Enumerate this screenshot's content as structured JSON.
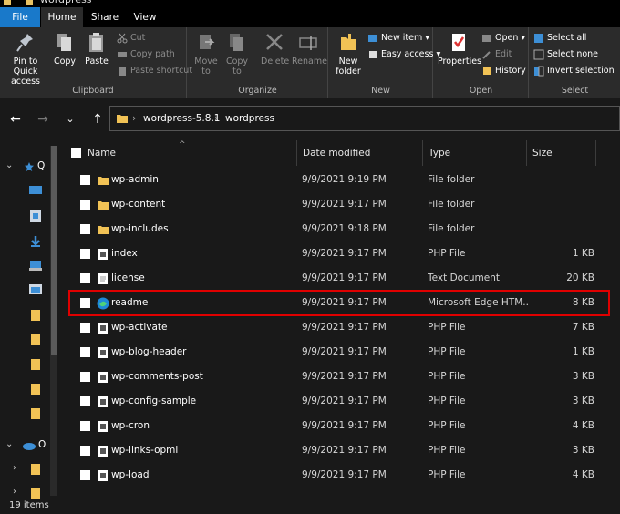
{
  "window": {
    "title": "wordpress"
  },
  "tabs": [
    {
      "label": "File",
      "active": false,
      "color": "#1979ca"
    },
    {
      "label": "Home",
      "active": true
    },
    {
      "label": "Share",
      "active": false
    },
    {
      "label": "View",
      "active": false
    }
  ],
  "ribbon": {
    "clipboard": {
      "label": "Clipboard",
      "pin": "Pin to Quick access",
      "copy": "Copy",
      "paste": "Paste",
      "cut": "Cut",
      "copy_path": "Copy path",
      "paste_shortcut": "Paste shortcut"
    },
    "organize": {
      "label": "Organize",
      "move_to": "Move to",
      "copy_to": "Copy to",
      "delete": "Delete",
      "rename": "Rename"
    },
    "new": {
      "label": "New",
      "new_folder": "New folder",
      "new_item": "New item",
      "easy_access": "Easy access"
    },
    "open": {
      "label": "Open",
      "properties": "Properties",
      "open": "Open",
      "edit": "Edit",
      "history": "History"
    },
    "select": {
      "label": "Select",
      "select_all": "Select all",
      "select_none": "Select none",
      "invert_selection": "Invert selection"
    }
  },
  "address": {
    "segments": [
      "wordpress-5.8.1",
      "wordpress"
    ]
  },
  "nav_pane": {
    "quick_access_initial": "Q",
    "onedrive_initial": "O"
  },
  "columns": {
    "name": "Name",
    "date": "Date modified",
    "type": "Type",
    "size": "Size"
  },
  "files": [
    {
      "name": "wp-admin",
      "date": "9/9/2021 9:19 PM",
      "type": "File folder",
      "size": "",
      "icon": "folder-icon"
    },
    {
      "name": "wp-content",
      "date": "9/9/2021 9:17 PM",
      "type": "File folder",
      "size": "",
      "icon": "folder-icon"
    },
    {
      "name": "wp-includes",
      "date": "9/9/2021 9:18 PM",
      "type": "File folder",
      "size": "",
      "icon": "folder-icon"
    },
    {
      "name": "index",
      "date": "9/9/2021 9:17 PM",
      "type": "PHP File",
      "size": "1 KB",
      "icon": "php-file-icon"
    },
    {
      "name": "license",
      "date": "9/9/2021 9:17 PM",
      "type": "Text Document",
      "size": "20 KB",
      "icon": "text-file-icon"
    },
    {
      "name": "readme",
      "date": "9/9/2021 9:17 PM",
      "type": "Microsoft Edge HTM...",
      "size": "8 KB",
      "icon": "edge-icon",
      "highlight": true
    },
    {
      "name": "wp-activate",
      "date": "9/9/2021 9:17 PM",
      "type": "PHP File",
      "size": "7 KB",
      "icon": "php-file-icon"
    },
    {
      "name": "wp-blog-header",
      "date": "9/9/2021 9:17 PM",
      "type": "PHP File",
      "size": "1 KB",
      "icon": "php-file-icon"
    },
    {
      "name": "wp-comments-post",
      "date": "9/9/2021 9:17 PM",
      "type": "PHP File",
      "size": "3 KB",
      "icon": "php-file-icon"
    },
    {
      "name": "wp-config-sample",
      "date": "9/9/2021 9:17 PM",
      "type": "PHP File",
      "size": "3 KB",
      "icon": "php-file-icon"
    },
    {
      "name": "wp-cron",
      "date": "9/9/2021 9:17 PM",
      "type": "PHP File",
      "size": "4 KB",
      "icon": "php-file-icon"
    },
    {
      "name": "wp-links-opml",
      "date": "9/9/2021 9:17 PM",
      "type": "PHP File",
      "size": "3 KB",
      "icon": "php-file-icon"
    },
    {
      "name": "wp-load",
      "date": "9/9/2021 9:17 PM",
      "type": "PHP File",
      "size": "4 KB",
      "icon": "php-file-icon"
    }
  ],
  "status": {
    "item_count": "19 items"
  }
}
